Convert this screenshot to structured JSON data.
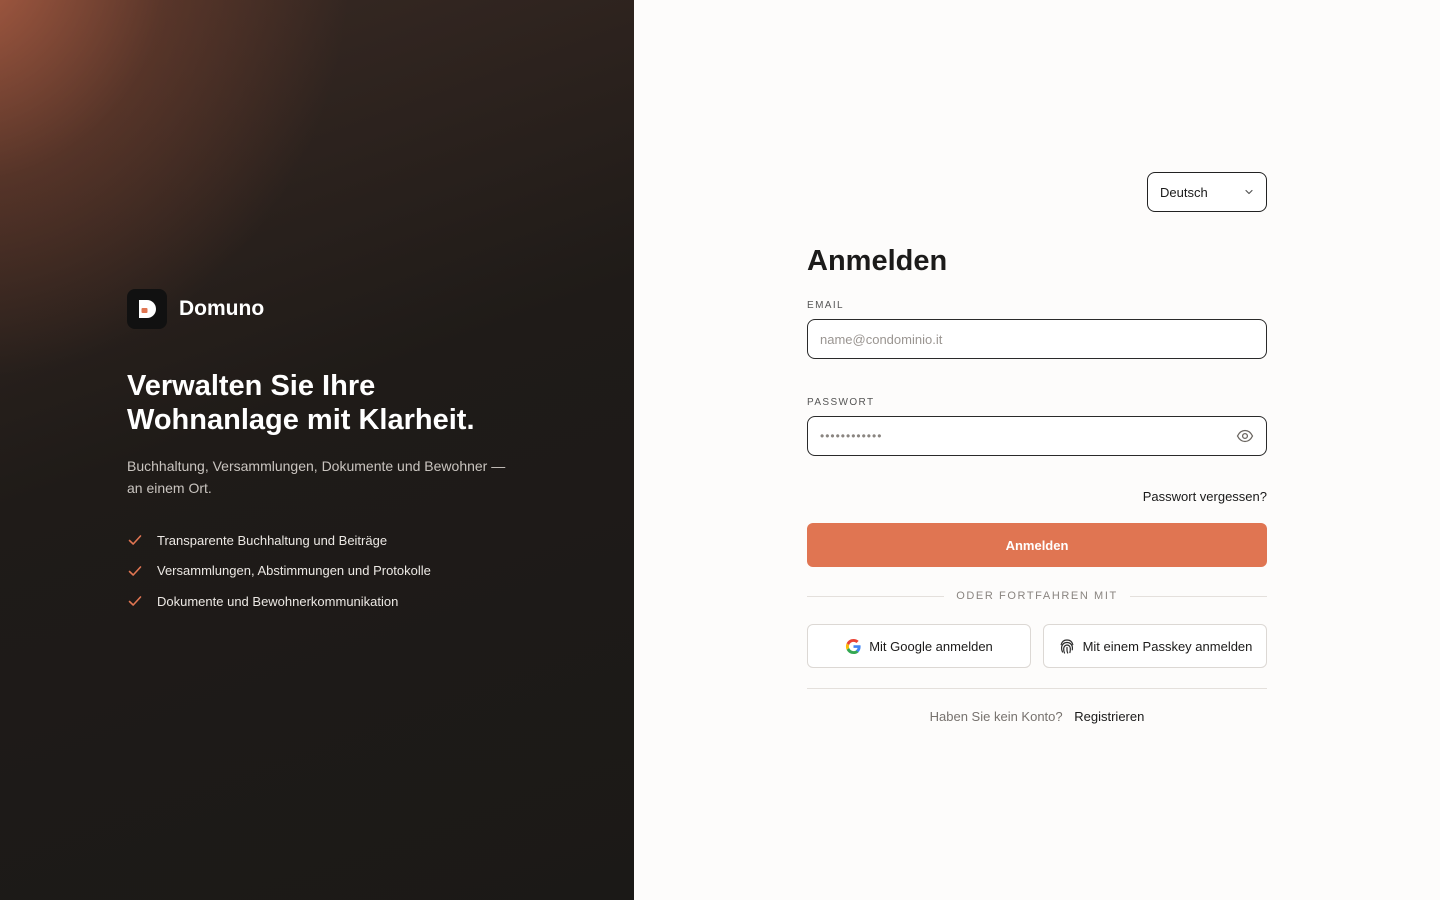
{
  "brand": {
    "name": "Domuno",
    "accent": "#e07552"
  },
  "hero": {
    "headline_line1": "Verwalten Sie Ihre",
    "headline_line2": "Wohnanlage mit Klarheit.",
    "subtitle_line1": "Buchhaltung, Versammlungen, Dokumente und Bewohner —",
    "subtitle_line2": "an einem Ort.",
    "features": [
      "Transparente Buchhaltung und Beiträge",
      "Versammlungen, Abstimmungen und Protokolle",
      "Dokumente und Bewohnerkommunikation"
    ]
  },
  "language": {
    "selected": "Deutsch"
  },
  "form": {
    "title": "Anmelden",
    "email_label": "EMAIL",
    "email_placeholder": "name@condominio.it",
    "password_label": "PASSWORT",
    "password_value": "••••••••••••",
    "forgot_link": "Passwort vergessen?",
    "submit_label": "Anmelden",
    "divider_text": "ODER FORTFAHREN MIT",
    "google_button": "Mit Google anmelden",
    "passkey_button": "Mit einem Passkey anmelden",
    "no_account_text": "Haben Sie kein Konto?",
    "register_link": "Registrieren"
  }
}
